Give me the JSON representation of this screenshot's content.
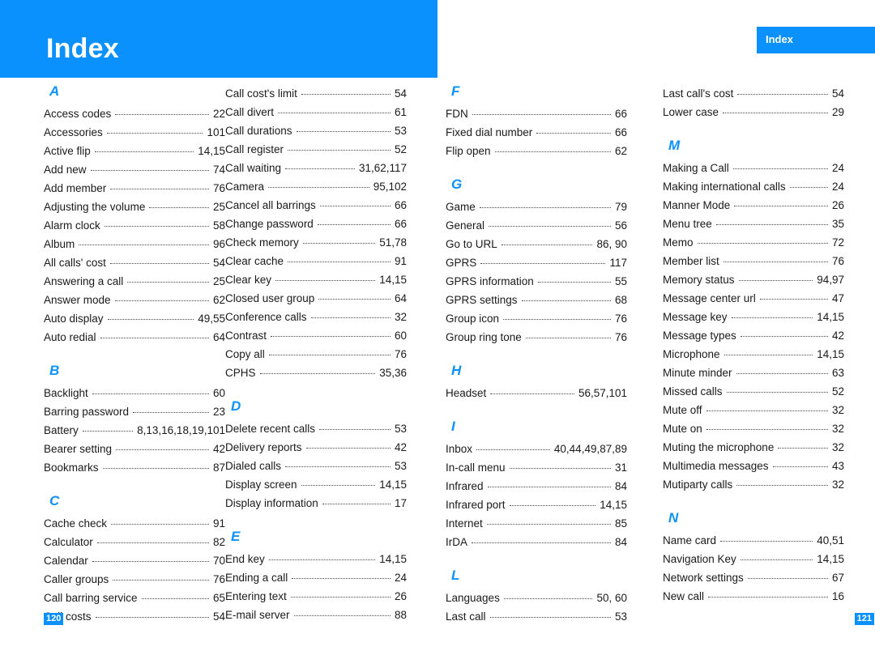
{
  "header": {
    "title": "Index",
    "tab_label": "Index"
  },
  "footer": {
    "page_left": "120",
    "page_right": "121"
  },
  "colors": {
    "accent": "#0a91fd",
    "text": "#1a1a1a",
    "leader": "#4d4d4d"
  },
  "columns": [
    {
      "id": "column-1",
      "sections": [
        {
          "letter": "A",
          "entries": [
            {
              "label": "Access codes",
              "page": "22"
            },
            {
              "label": "Accessories",
              "page": "101"
            },
            {
              "label": "Active flip",
              "page": "14,15"
            },
            {
              "label": "Add new",
              "page": "74"
            },
            {
              "label": "Add member",
              "page": "76"
            },
            {
              "label": "Adjusting the volume",
              "page": "25"
            },
            {
              "label": "Alarm clock",
              "page": "58"
            },
            {
              "label": "Album",
              "page": "96"
            },
            {
              "label": "All calls' cost",
              "page": "54"
            },
            {
              "label": "Answering a call",
              "page": "25"
            },
            {
              "label": "Answer mode",
              "page": "62"
            },
            {
              "label": "Auto display",
              "page": "49,55"
            },
            {
              "label": "Auto redial",
              "page": "64"
            }
          ]
        },
        {
          "letter": "B",
          "entries": [
            {
              "label": "Backlight",
              "page": "60"
            },
            {
              "label": "Barring password",
              "page": "23"
            },
            {
              "label": "Battery",
              "page": "8,13,16,18,19,101"
            },
            {
              "label": "Bearer setting",
              "page": "42"
            },
            {
              "label": "Bookmarks",
              "page": "87"
            }
          ]
        },
        {
          "letter": "C",
          "entries": [
            {
              "label": "Cache check",
              "page": "91"
            },
            {
              "label": "Calculator",
              "page": "82"
            },
            {
              "label": "Calendar",
              "page": "70"
            },
            {
              "label": "Caller groups",
              "page": "76"
            },
            {
              "label": "Call barring service",
              "page": "65"
            },
            {
              "label": "Call costs",
              "page": "54"
            }
          ]
        }
      ]
    },
    {
      "id": "column-2",
      "sections": [
        {
          "letter": "",
          "entries": [
            {
              "label": "Call cost's limit",
              "page": "54"
            },
            {
              "label": "Call divert",
              "page": "61"
            },
            {
              "label": "Call durations",
              "page": "53"
            },
            {
              "label": "Call register",
              "page": "52"
            },
            {
              "label": "Call waiting",
              "page": "31,62,117"
            },
            {
              "label": "Camera",
              "page": "95,102"
            },
            {
              "label": "Cancel all barrings",
              "page": "66"
            },
            {
              "label": "Change password",
              "page": "66"
            },
            {
              "label": "Check memory",
              "page": "51,78"
            },
            {
              "label": "Clear cache",
              "page": "91"
            },
            {
              "label": "Clear key",
              "page": "14,15"
            },
            {
              "label": "Closed user group",
              "page": "64"
            },
            {
              "label": "Conference calls",
              "page": "32"
            },
            {
              "label": "Contrast",
              "page": "60"
            },
            {
              "label": "Copy all",
              "page": "76"
            },
            {
              "label": "CPHS",
              "page": "35,36"
            }
          ]
        },
        {
          "letter": "D",
          "entries": [
            {
              "label": "Delete recent calls",
              "page": "53"
            },
            {
              "label": "Delivery reports",
              "page": "42"
            },
            {
              "label": "Dialed calls",
              "page": "53"
            },
            {
              "label": "Display screen",
              "page": "14,15"
            },
            {
              "label": "Display information",
              "page": "17"
            }
          ]
        },
        {
          "letter": "E",
          "entries": [
            {
              "label": "End key",
              "page": "14,15"
            },
            {
              "label": "Ending a call",
              "page": "24"
            },
            {
              "label": "Entering text",
              "page": "26"
            },
            {
              "label": "E-mail server",
              "page": "88"
            }
          ]
        }
      ]
    },
    {
      "id": "column-3",
      "sections": [
        {
          "letter": "F",
          "entries": [
            {
              "label": "FDN",
              "page": "66"
            },
            {
              "label": "Fixed dial number",
              "page": "66"
            },
            {
              "label": "Flip open",
              "page": "62"
            }
          ]
        },
        {
          "letter": "G",
          "entries": [
            {
              "label": "Game",
              "page": "79"
            },
            {
              "label": "General",
              "page": "56"
            },
            {
              "label": "Go to URL",
              "page": "86, 90"
            },
            {
              "label": "GPRS",
              "page": "117"
            },
            {
              "label": "GPRS information",
              "page": "55"
            },
            {
              "label": "GPRS settings",
              "page": "68"
            },
            {
              "label": "Group icon",
              "page": "76"
            },
            {
              "label": "Group ring tone",
              "page": "76"
            }
          ]
        },
        {
          "letter": "H",
          "entries": [
            {
              "label": "Headset",
              "page": "56,57,101"
            }
          ]
        },
        {
          "letter": "I",
          "entries": [
            {
              "label": "Inbox",
              "page": "40,44,49,87,89"
            },
            {
              "label": "In-call menu",
              "page": "31"
            },
            {
              "label": "Infrared",
              "page": "84"
            },
            {
              "label": "Infrared port",
              "page": "14,15"
            },
            {
              "label": "Internet",
              "page": "85"
            },
            {
              "label": "IrDA",
              "page": "84"
            }
          ]
        },
        {
          "letter": "L",
          "entries": [
            {
              "label": "Languages",
              "page": "50, 60"
            },
            {
              "label": "Last call",
              "page": "53"
            }
          ]
        }
      ]
    },
    {
      "id": "column-4",
      "sections": [
        {
          "letter": "",
          "entries": [
            {
              "label": "Last call's cost",
              "page": "54"
            },
            {
              "label": "Lower case",
              "page": "29"
            }
          ]
        },
        {
          "letter": "M",
          "entries": [
            {
              "label": "Making a Call",
              "page": "24"
            },
            {
              "label": "Making international calls",
              "page": "24"
            },
            {
              "label": "Manner Mode",
              "page": "26"
            },
            {
              "label": "Menu tree",
              "page": "35"
            },
            {
              "label": "Memo",
              "page": "72"
            },
            {
              "label": "Member list",
              "page": "76"
            },
            {
              "label": "Memory status",
              "page": "94,97"
            },
            {
              "label": "Message center url",
              "page": "47"
            },
            {
              "label": "Message key",
              "page": "14,15"
            },
            {
              "label": "Message types",
              "page": "42"
            },
            {
              "label": "Microphone",
              "page": "14,15"
            },
            {
              "label": "Minute minder",
              "page": "63"
            },
            {
              "label": "Missed calls",
              "page": "52"
            },
            {
              "label": "Mute off",
              "page": "32"
            },
            {
              "label": "Mute on",
              "page": "32"
            },
            {
              "label": "Muting the microphone",
              "page": "32"
            },
            {
              "label": "Multimedia messages",
              "page": "43"
            },
            {
              "label": "Mutiparty calls",
              "page": "32"
            }
          ]
        },
        {
          "letter": "N",
          "entries": [
            {
              "label": "Name card",
              "page": "40,51"
            },
            {
              "label": "Navigation Key",
              "page": "14,15"
            },
            {
              "label": "Network settings",
              "page": "67"
            },
            {
              "label": "New call",
              "page": "16"
            }
          ]
        }
      ]
    }
  ]
}
